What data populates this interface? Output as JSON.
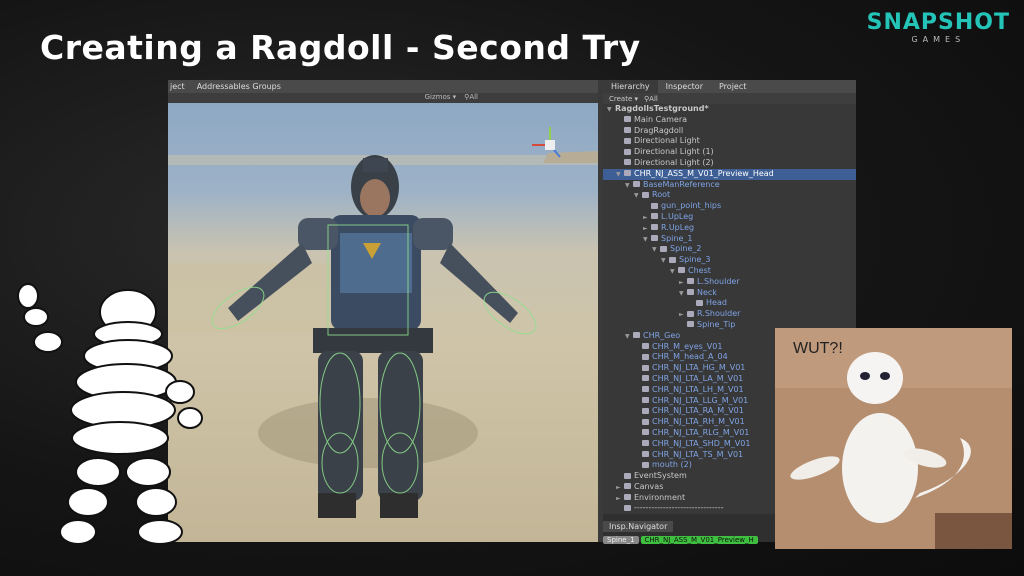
{
  "slide": {
    "title": "Creating a Ragdoll - Second Try"
  },
  "logo": {
    "main": "SNAPSHOT",
    "sub": "GAMES"
  },
  "scene": {
    "tabs": [
      "ject",
      "Addressables Groups"
    ],
    "toolbar": {
      "gizmos": "Gizmos",
      "search": "All"
    }
  },
  "hierarchy": {
    "tabs": [
      "Hierarchy",
      "Inspector",
      "Project"
    ],
    "create_label": "Create",
    "search": "All",
    "rows": [
      {
        "label": "RagdollsTestground*",
        "indent": 0,
        "arrow": "▼",
        "bold": true
      },
      {
        "label": "Main Camera",
        "indent": 1
      },
      {
        "label": "DragRagdoll",
        "indent": 1
      },
      {
        "label": "Directional Light",
        "indent": 1
      },
      {
        "label": "Directional Light (1)",
        "indent": 1
      },
      {
        "label": "Directional Light (2)",
        "indent": 1
      },
      {
        "label": "CHR_NJ_ASS_M_V01_Preview_Head",
        "indent": 1,
        "arrow": "▼",
        "selected": true
      },
      {
        "label": "BaseManReference",
        "indent": 2,
        "arrow": "▼",
        "blue": true
      },
      {
        "label": "Root",
        "indent": 3,
        "arrow": "▼",
        "blue": true
      },
      {
        "label": "gun_point_hips",
        "indent": 4,
        "blue": true
      },
      {
        "label": "L.UpLeg",
        "indent": 4,
        "arrow": "►",
        "blue": true
      },
      {
        "label": "R.UpLeg",
        "indent": 4,
        "arrow": "►",
        "blue": true
      },
      {
        "label": "Spine_1",
        "indent": 4,
        "arrow": "▼",
        "blue": true
      },
      {
        "label": "Spine_2",
        "indent": 5,
        "arrow": "▼",
        "blue": true
      },
      {
        "label": "Spine_3",
        "indent": 6,
        "arrow": "▼",
        "blue": true
      },
      {
        "label": "Chest",
        "indent": 7,
        "arrow": "▼",
        "blue": true
      },
      {
        "label": "L.Shoulder",
        "indent": 8,
        "arrow": "►",
        "blue": true
      },
      {
        "label": "Neck",
        "indent": 8,
        "arrow": "▼",
        "blue": true
      },
      {
        "label": "Head",
        "indent": 9,
        "blue": true
      },
      {
        "label": "R.Shoulder",
        "indent": 8,
        "arrow": "►",
        "blue": true
      },
      {
        "label": "Spine_Tip",
        "indent": 8,
        "blue": true
      },
      {
        "label": "CHR_Geo",
        "indent": 2,
        "arrow": "▼",
        "blue": true
      },
      {
        "label": "CHR_M_eyes_V01",
        "indent": 3,
        "blue": true
      },
      {
        "label": "CHR_M_head_A_04",
        "indent": 3,
        "blue": true
      },
      {
        "label": "CHR_NJ_LTA_HG_M_V01",
        "indent": 3,
        "blue": true
      },
      {
        "label": "CHR_NJ_LTA_LA_M_V01",
        "indent": 3,
        "blue": true
      },
      {
        "label": "CHR_NJ_LTA_LH_M_V01",
        "indent": 3,
        "blue": true
      },
      {
        "label": "CHR_NJ_LTA_LLG_M_V01",
        "indent": 3,
        "blue": true
      },
      {
        "label": "CHR_NJ_LTA_RA_M_V01",
        "indent": 3,
        "blue": true
      },
      {
        "label": "CHR_NJ_LTA_RH_M_V01",
        "indent": 3,
        "blue": true
      },
      {
        "label": "CHR_NJ_LTA_RLG_M_V01",
        "indent": 3,
        "blue": true
      },
      {
        "label": "CHR_NJ_LTA_SHD_M_V01",
        "indent": 3,
        "blue": true
      },
      {
        "label": "CHR_NJ_LTA_TS_M_V01",
        "indent": 3,
        "blue": true
      },
      {
        "label": "mouth (2)",
        "indent": 3,
        "blue": true
      },
      {
        "label": "EventSystem",
        "indent": 1
      },
      {
        "label": "Canvas",
        "indent": 1,
        "arrow": "►"
      },
      {
        "label": "Environment",
        "indent": 1,
        "arrow": "►"
      },
      {
        "label": "-------------------------------",
        "indent": 1
      }
    ]
  },
  "navigator": {
    "tab": "Insp.Navigator",
    "crumbs": [
      {
        "label": "Spine_1",
        "color": "#888888"
      },
      {
        "label": "CHR_NJ_ASS_M_V01_Preview_H",
        "color": "#3fbf3f"
      }
    ]
  },
  "meme": {
    "caption": "WUT?!"
  },
  "colors": {
    "accent": "#24c5b8",
    "selection": "#3d5f96",
    "hier_blue": "#7fa4e6"
  }
}
